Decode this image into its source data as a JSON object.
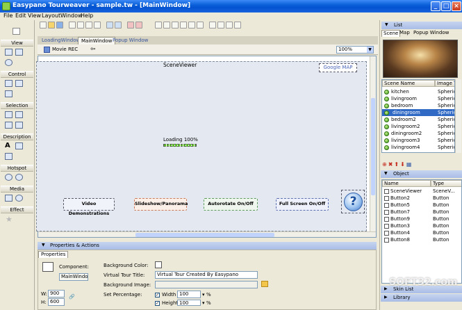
{
  "window": {
    "title": "Easypano Tourweaver - sample.tw - [MainWindow]",
    "minimize": "_",
    "maximize": "□",
    "close": "×"
  },
  "menu": [
    "File",
    "Edit",
    "View",
    "Layout",
    "Window",
    "Help"
  ],
  "palette": {
    "sections": [
      "View",
      "Control",
      "Selection",
      "Description",
      "Hotspot",
      "Media",
      "Effect"
    ]
  },
  "tabs": [
    "LoadingWindow",
    "MainWindow",
    "Popup Window"
  ],
  "subbar": {
    "movie_rec": "Movie REC",
    "zoom": "100%"
  },
  "viewer": {
    "title": "SceneViewer",
    "google_map": "Google MAP",
    "loading": "Loading 100%",
    "buttons": [
      "Video Demonstrations",
      "Slideshow/Panorama",
      "Autorotate On/Off",
      "Full Screen On/Off"
    ],
    "help_glyph": "?"
  },
  "properties": {
    "header": "Properties & Actions",
    "tab": "Properties",
    "component_label": "Component:",
    "component_value": "MainWindow",
    "w_label": "W:",
    "w_value": "900",
    "h_label": "H:",
    "h_value": "600",
    "bg_color_label": "Background Color:",
    "tour_title_label": "Virtual Tour Title:",
    "tour_title_value": "Virtual Tour Created By Easypano",
    "bg_image_label": "Background Image:",
    "set_pct_label": "Set Percentage:",
    "width_label": "Width",
    "width_value": "100",
    "height_label": "Height",
    "height_value": "100",
    "pct": "%"
  },
  "list_panel": {
    "header": "List",
    "tabs": [
      "Scene",
      "Map",
      "Popup Window"
    ],
    "columns": [
      "Scene Name",
      "Image T"
    ],
    "scenes": [
      {
        "name": "kitchen",
        "type": "Spheric"
      },
      {
        "name": "livingroom",
        "type": "Spheric"
      },
      {
        "name": "bedroom",
        "type": "Spheric"
      },
      {
        "name": "diningroom",
        "type": "Spheric"
      },
      {
        "name": "bedroom2",
        "type": "Spheric"
      },
      {
        "name": "livingroom2",
        "type": "Spheric"
      },
      {
        "name": "diningroom2",
        "type": "Spheric"
      },
      {
        "name": "livingroom3",
        "type": "Spheric"
      },
      {
        "name": "livingroom4",
        "type": "Spheric"
      }
    ],
    "selected_index": 3
  },
  "object_panel": {
    "header": "Object",
    "columns": [
      "Name",
      "Type"
    ],
    "objects": [
      {
        "name": "SceneViewer",
        "type": "SceneV..."
      },
      {
        "name": "Button2",
        "type": "Button"
      },
      {
        "name": "Button5",
        "type": "Button"
      },
      {
        "name": "Button7",
        "type": "Button"
      },
      {
        "name": "Button9",
        "type": "Button"
      },
      {
        "name": "Button3",
        "type": "Button"
      },
      {
        "name": "Button4",
        "type": "Button"
      },
      {
        "name": "Button8",
        "type": "Button"
      }
    ]
  },
  "bottom_panels": [
    "Skin List",
    "Library"
  ],
  "watermark": "SOFT32.com",
  "colors": {
    "titlebar": "#0a5fd8",
    "selection": "#316ac5",
    "panel_header": "#a9bde6",
    "viewer_bg": "#e4e9f1"
  }
}
